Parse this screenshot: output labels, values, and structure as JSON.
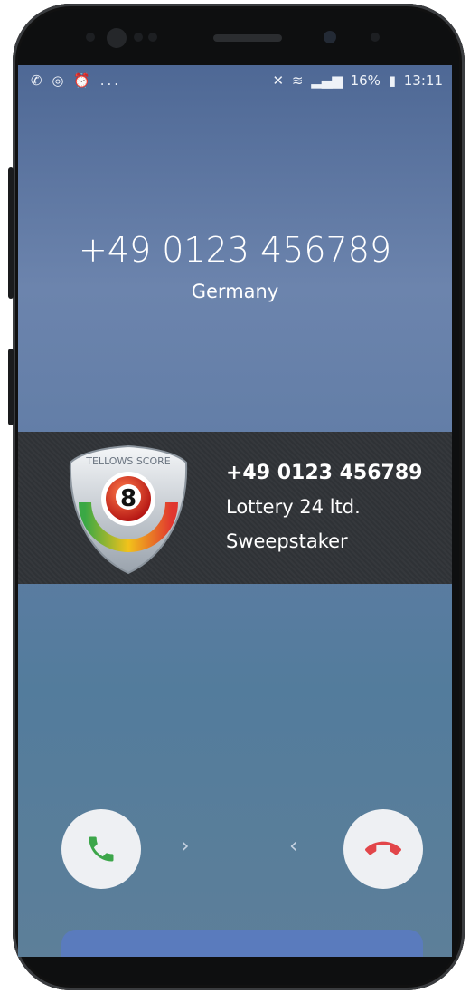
{
  "status_bar": {
    "left_icons": [
      "phone-icon",
      "alarm-icon",
      "clock-icon"
    ],
    "left_more": "...",
    "battery": "16%",
    "time": "13:11"
  },
  "call": {
    "number": "+49 0123 456789",
    "country": "Germany"
  },
  "tellows_banner": {
    "badge_text": "TELLOWS SCORE",
    "score": "8",
    "number": "+49 0123 456789",
    "name": "Lottery 24 ltd.",
    "category": "Sweepstaker"
  },
  "controls": {
    "answer_icon": "phone-answer-icon",
    "decline_icon": "phone-decline-icon",
    "chevron_right": "›",
    "chevron_left": "‹"
  },
  "colors": {
    "answer": "#3ca64a",
    "decline": "#e2464a",
    "banner_bg": "#323539"
  }
}
